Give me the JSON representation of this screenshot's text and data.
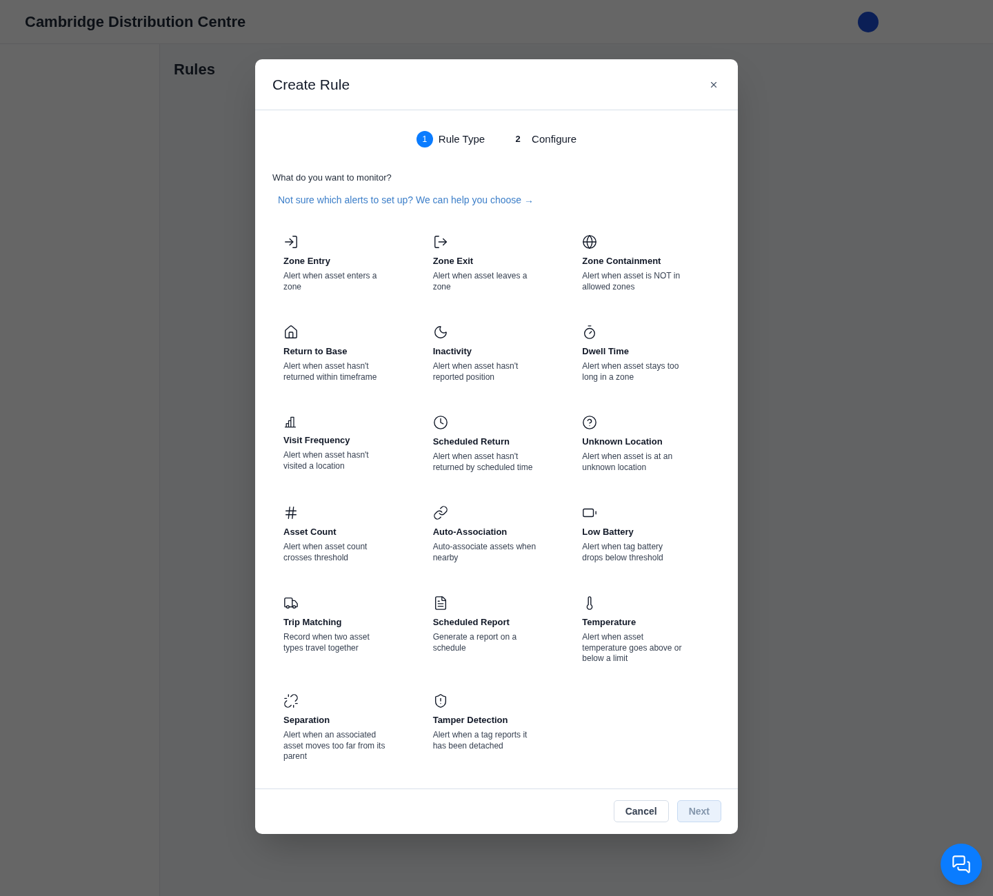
{
  "app_header": {
    "title": "Cambridge Distribution Centre"
  },
  "page": {
    "heading": "Rules"
  },
  "dialog": {
    "title": "Create Rule",
    "steps": [
      {
        "number": "1",
        "label": "Rule Type",
        "selected": true
      },
      {
        "number": "2",
        "label": "Configure",
        "selected": false
      }
    ],
    "question": "What do you want to monitor?",
    "help_link": "Not sure which alerts to set up? We can help you choose →",
    "rule_types": [
      {
        "title": "Zone Entry",
        "description": "Alert when asset enters a zone"
      },
      {
        "title": "Zone Exit",
        "description": "Alert when asset leaves a zone"
      },
      {
        "title": "Zone Containment",
        "description": "Alert when asset is NOT in allowed zones"
      },
      {
        "title": "Return to Base",
        "description": "Alert when asset hasn't returned within timeframe"
      },
      {
        "title": "Inactivity",
        "description": "Alert when asset hasn't reported position"
      },
      {
        "title": "Dwell Time",
        "description": "Alert when asset stays too long in a zone"
      },
      {
        "title": "Visit Frequency",
        "description": "Alert when asset hasn't visited a location"
      },
      {
        "title": "Scheduled Return",
        "description": "Alert when asset hasn't returned by scheduled time"
      },
      {
        "title": "Unknown Location",
        "description": "Alert when asset is at an unknown location"
      },
      {
        "title": "Asset Count",
        "description": "Alert when asset count crosses threshold"
      },
      {
        "title": "Auto-Association",
        "description": "Auto-associate assets when nearby"
      },
      {
        "title": "Low Battery",
        "description": "Alert when tag battery drops below threshold"
      },
      {
        "title": "Trip Matching",
        "description": "Record when two asset types travel together"
      },
      {
        "title": "Scheduled Report",
        "description": "Generate a report on a schedule"
      },
      {
        "title": "Temperature",
        "description": "Alert when asset temperature goes above or below a limit"
      },
      {
        "title": "Separation",
        "description": "Alert when an associated asset moves too far from its parent"
      },
      {
        "title": "Tamper Detection",
        "description": "Alert when a tag reports it has been detached"
      }
    ],
    "buttons": [
      {
        "label": "Cancel",
        "kind": "secondary",
        "disabled": false
      },
      {
        "label": "Next",
        "kind": "primary",
        "disabled": true
      }
    ]
  }
}
